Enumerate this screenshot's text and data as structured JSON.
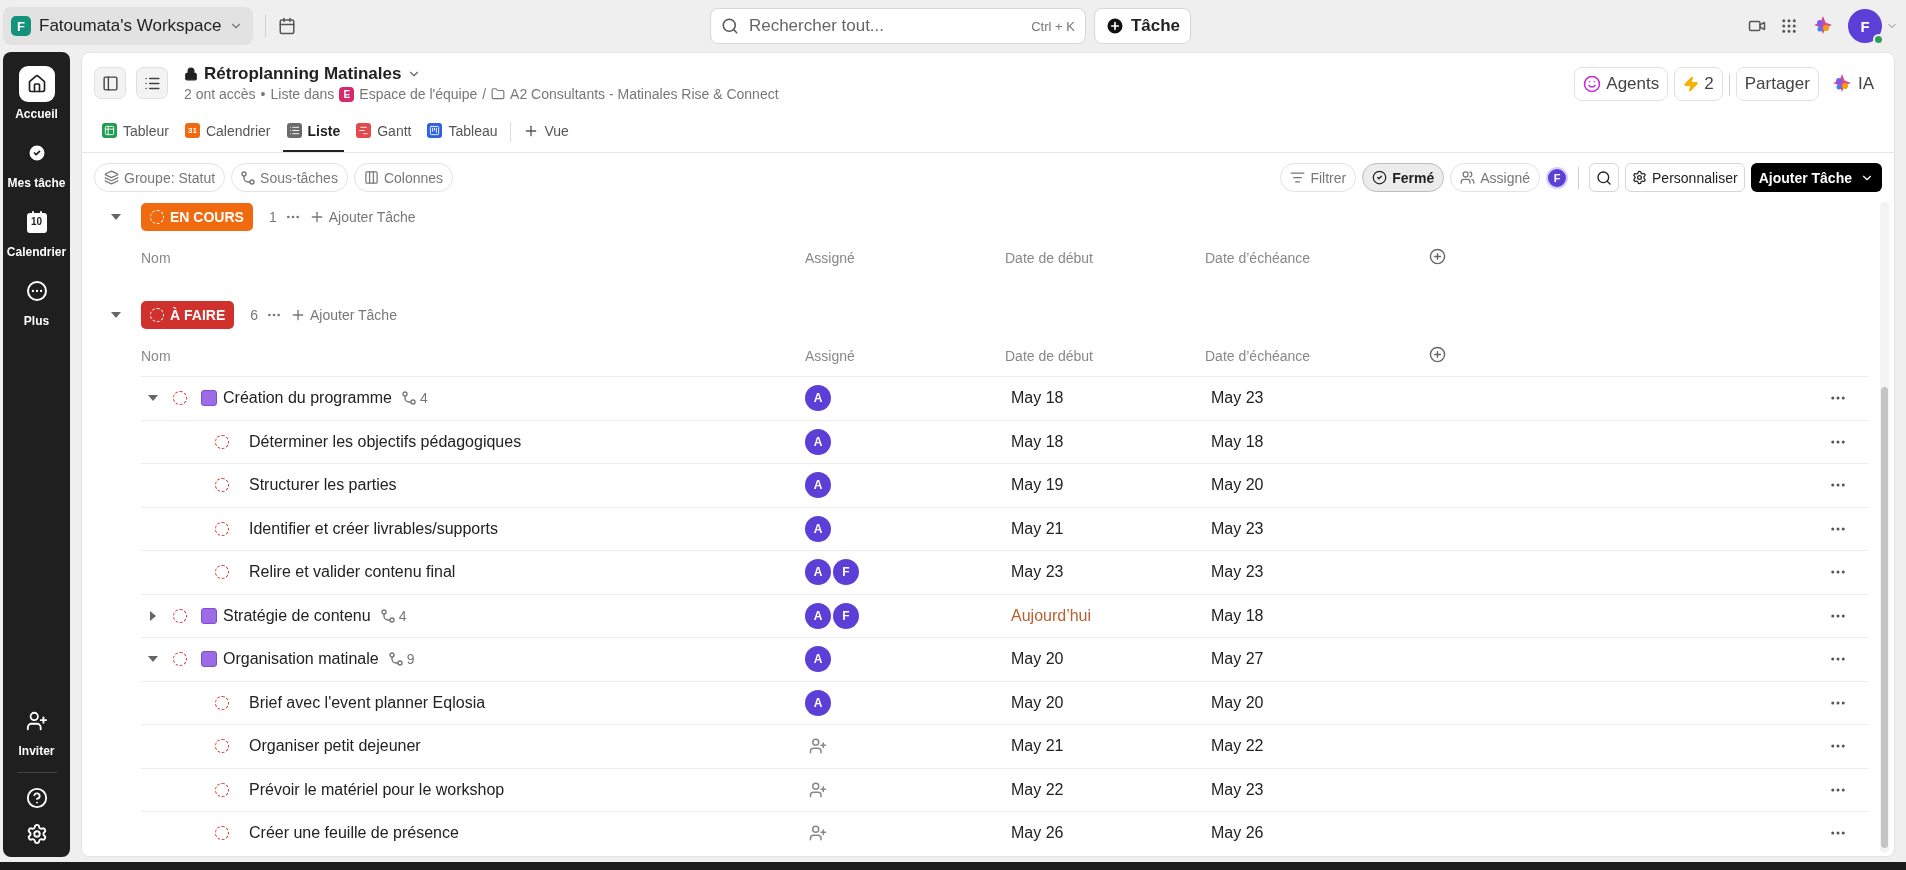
{
  "topbar": {
    "workspace": {
      "initial": "F",
      "name": "Fatoumata's Workspace"
    },
    "search": {
      "placeholder": "Rechercher tout...",
      "shortcut": "Ctrl + K"
    },
    "new_task": "Tâche",
    "user_initial": "F"
  },
  "sidebar": {
    "items": [
      {
        "label": "Accueil",
        "kind": "home",
        "selected": true
      },
      {
        "label": "Mes tâche",
        "kind": "tasks",
        "selected": false
      },
      {
        "label": "Calendrier",
        "kind": "calendar",
        "icon_text": "10",
        "selected": false
      },
      {
        "label": "Plus",
        "kind": "more",
        "selected": false
      }
    ],
    "invite": "Inviter"
  },
  "page": {
    "title": "Rétroplanning Matinales",
    "access": "2 ont accès",
    "bullet": "•",
    "list_in": "Liste dans",
    "path_separator": "/",
    "space_initial": "E",
    "space": "Espace de l'équipe",
    "folder": "A2 Consultants - Matinales Rise & Connect",
    "actions": {
      "agents": "Agents",
      "automations": "2",
      "share": "Partager",
      "ai": "IA"
    },
    "tabs": [
      {
        "label": "Tableur",
        "kind": "table",
        "selected": false
      },
      {
        "label": "Calendrier",
        "kind": "calendar",
        "icon_text": "31",
        "selected": false
      },
      {
        "label": "Liste",
        "kind": "list",
        "selected": true
      },
      {
        "label": "Gantt",
        "kind": "gantt",
        "selected": false
      },
      {
        "label": "Tableau",
        "kind": "board",
        "selected": false
      }
    ],
    "add_view": "Vue"
  },
  "toolbar": {
    "left": [
      {
        "label": "Groupe: Statut",
        "kind": "group"
      },
      {
        "label": "Sous-tâches",
        "kind": "subtasks"
      },
      {
        "label": "Colonnes",
        "kind": "columns"
      }
    ],
    "filters": [
      {
        "label": "Filtrer",
        "kind": "filter",
        "selected": false
      },
      {
        "label": "Fermé",
        "kind": "closed",
        "selected": true
      },
      {
        "label": "Assigné",
        "kind": "assignee",
        "selected": false
      }
    ],
    "me_initial": "F",
    "customize": "Personnaliser",
    "add_task": "Ajouter Tâche"
  },
  "groups": [
    {
      "status": "EN COURS",
      "color": "#f06a0f",
      "count": "1",
      "add": "Ajouter Tâche",
      "expanded": true,
      "columns": [
        "Nom",
        "Assigné",
        "Date de début",
        "Date d’échéance"
      ]
    },
    {
      "status": "À FAIRE",
      "color": "#d0312d",
      "count": "6",
      "add": "Ajouter Tâche",
      "expanded": true,
      "columns": [
        "Nom",
        "Assigné",
        "Date de début",
        "Date d’échéance"
      ],
      "tasks": [
        {
          "name": "Création du programme",
          "subtasks": "4",
          "expanded": true,
          "assignees": [
            "A"
          ],
          "start": "May 18",
          "start_today": false,
          "due": "May 23",
          "children": [
            {
              "name": "Déterminer les objectifs pédagogiques",
              "assignees": [
                "A"
              ],
              "start": "May 18",
              "start_today": false,
              "due": "May 18"
            },
            {
              "name": "Structurer les parties",
              "assignees": [
                "A"
              ],
              "start": "May 19",
              "start_today": false,
              "due": "May 20"
            },
            {
              "name": "Identifier et créer livrables/supports",
              "assignees": [
                "A"
              ],
              "start": "May 21",
              "start_today": false,
              "due": "May 23"
            },
            {
              "name": "Relire et valider contenu final",
              "assignees": [
                "A",
                "F"
              ],
              "start": "May 23",
              "start_today": false,
              "due": "May 23"
            }
          ]
        },
        {
          "name": "Stratégie de contenu",
          "subtasks": "4",
          "expanded": false,
          "assignees": [
            "A",
            "F"
          ],
          "start": "Aujourd’hui",
          "start_today": true,
          "due": "May 18"
        },
        {
          "name": "Organisation matinale",
          "subtasks": "9",
          "expanded": true,
          "assignees": [
            "A"
          ],
          "start": "May 20",
          "start_today": false,
          "due": "May 27",
          "children": [
            {
              "name": "Brief avec l'event planner Eqlosia",
              "assignees": [
                "A"
              ],
              "start": "May 20",
              "start_today": false,
              "due": "May 20"
            },
            {
              "name": "Organiser petit dejeuner",
              "start": "May 21",
              "start_today": false,
              "due": "May 22"
            },
            {
              "name": "Prévoir le matériel pour le workshop",
              "start": "May 22",
              "start_today": false,
              "due": "May 23"
            },
            {
              "name": "Créer une feuille de présence",
              "start": "May 26",
              "start_today": false,
              "due": "May 26"
            }
          ]
        }
      ]
    }
  ]
}
